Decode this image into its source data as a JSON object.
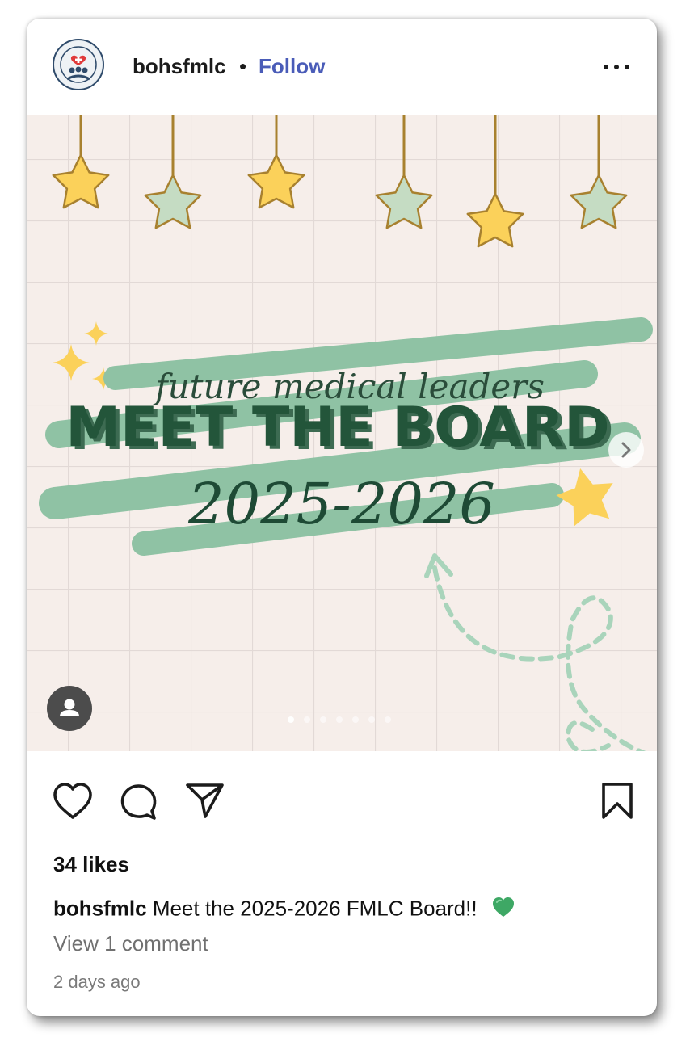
{
  "header": {
    "username": "bohsfmlc",
    "separator": "•",
    "follow_label": "Follow"
  },
  "post_image": {
    "script_text": "future medical leaders",
    "headline": "MEET THE BOARD",
    "years": "2025-2026",
    "colors": {
      "background": "#f6eeea",
      "grid": "#e2d9d6",
      "brush": "#8fc2a4",
      "headline": "#23553a",
      "star_yellow": "#fbd15a",
      "star_green": "#c5dcc3"
    },
    "carousel_total": 7,
    "carousel_active": 1
  },
  "actions": {
    "like": "heart-icon",
    "comment": "comment-icon",
    "share": "send-icon",
    "save": "bookmark-icon"
  },
  "likes_text": "34 likes",
  "caption": {
    "username": "bohsfmlc",
    "text": "Meet the 2025-2026 FMLC Board!!",
    "emoji": "green-heart-icon"
  },
  "view_comments": "View 1 comment",
  "timestamp": "2 days ago"
}
